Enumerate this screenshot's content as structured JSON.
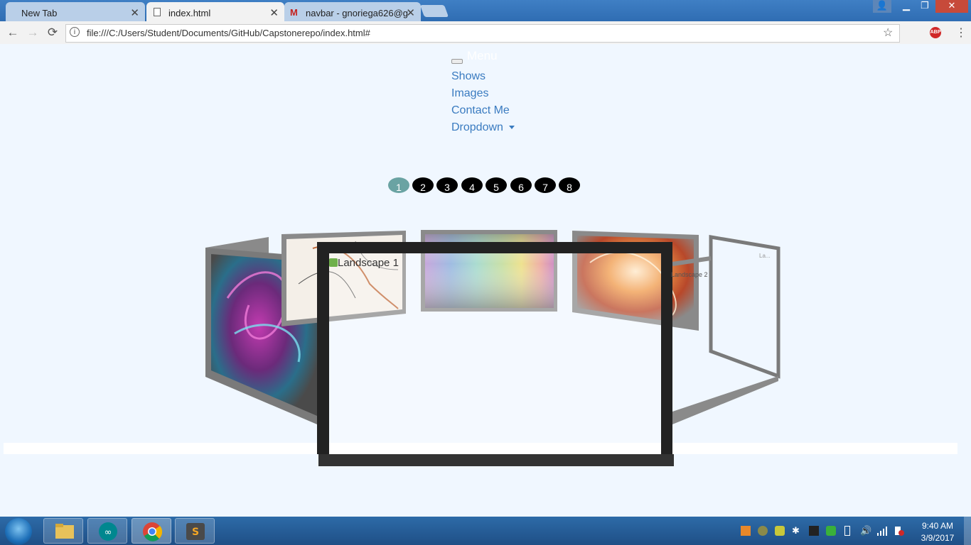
{
  "browser": {
    "tabs": [
      {
        "label": "New Tab",
        "active": false
      },
      {
        "label": "index.html",
        "active": true
      },
      {
        "label": "navbar - gnoriega626@g",
        "active": false
      }
    ],
    "url": "file:///C:/Users/Student/Documents/GitHub/Capstonerepo/index.html#",
    "icons": [
      "back-icon",
      "forward-icon",
      "reload-icon",
      "info-icon",
      "star-icon",
      "adblock-icon",
      "menu-icon"
    ],
    "abp_label": "ABP"
  },
  "navbar": {
    "toggle_label": "Menu",
    "links": [
      {
        "label": "Shows"
      },
      {
        "label": "Images"
      },
      {
        "label": "Contact Me"
      },
      {
        "label": "Dropdown"
      }
    ]
  },
  "slider": {
    "dots": [
      "1",
      "2",
      "3",
      "4",
      "5",
      "6",
      "7",
      "8"
    ],
    "active_index": 0
  },
  "carousel": {
    "front_image_alt": "Landscape 1",
    "right_image_alt": "Landscape 2",
    "far_right_alt": "La..."
  },
  "taskbar": {
    "time": "9:40 AM",
    "date": "3/9/2017"
  },
  "colors": {
    "link": "#3a7bc0",
    "page_bg": "#f0f7ff",
    "dot_active": "#6aa3a3",
    "dot": "#000000"
  }
}
